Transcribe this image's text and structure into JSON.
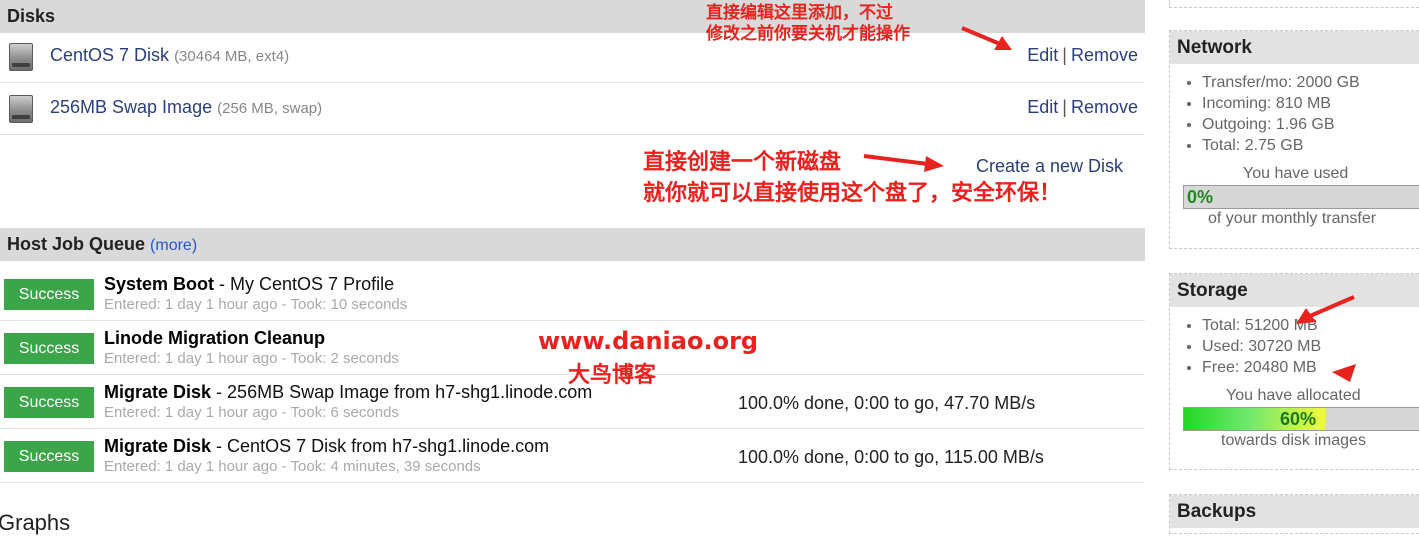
{
  "disks": {
    "header": "Disks",
    "items": [
      {
        "name": "CentOS 7 Disk",
        "meta": "(30464 MB, ext4)",
        "edit": "Edit",
        "remove": "Remove"
      },
      {
        "name": "256MB Swap Image",
        "meta": "(256 MB, swap)",
        "edit": "Edit",
        "remove": "Remove"
      }
    ],
    "create_label": "Create a new Disk",
    "separator": "|"
  },
  "annotations": {
    "edit_note_line1": "直接编辑这里添加，不过",
    "edit_note_line2": "修改之前你要关机才能操作",
    "create_note_line1": "直接创建一个新磁盘",
    "create_note_line2": "就你就可以直接使用这个盘了，安全环保！",
    "watermark_url": "www.daniao.org",
    "watermark_name": "大鸟博客"
  },
  "jobs": {
    "header": "Host Job Queue",
    "more": "(more)",
    "items": [
      {
        "status": "Success",
        "title_bold": "System Boot",
        "title_rest": " - My CentOS 7 Profile",
        "sub": "Entered: 1 day 1 hour ago - Took: 10 seconds",
        "progress": ""
      },
      {
        "status": "Success",
        "title_bold": "Linode Migration Cleanup",
        "title_rest": "",
        "sub": "Entered: 1 day 1 hour ago - Took: 2 seconds",
        "progress": ""
      },
      {
        "status": "Success",
        "title_bold": "Migrate Disk",
        "title_rest": " - 256MB Swap Image from h7-shg1.linode.com",
        "sub": "Entered: 1 day 1 hour ago - Took: 6 seconds",
        "progress": "100.0% done, 0:00 to go, 47.70 MB/s"
      },
      {
        "status": "Success",
        "title_bold": "Migrate Disk",
        "title_rest": " - CentOS 7 Disk from h7-shg1.linode.com",
        "sub": "Entered: 1 day 1 hour ago - Took: 4 minutes, 39 seconds",
        "progress": "100.0% done, 0:00 to go, 115.00 MB/s"
      }
    ]
  },
  "graphs": {
    "title": "Graphs"
  },
  "network": {
    "header": "Network",
    "items": [
      "Transfer/mo: 2000 GB",
      "Incoming: 810 MB",
      "Outgoing: 1.96 GB",
      "Total: 2.75 GB"
    ],
    "used_label": "You have used",
    "percent_label": "0%",
    "percent_value": 0,
    "caption": "of your monthly transfer"
  },
  "storage": {
    "header": "Storage",
    "items": [
      "Total: 51200 MB",
      "Used: 30720 MB",
      "Free: 20480 MB"
    ],
    "alloc_label": "You have allocated",
    "percent_label": "60%",
    "percent_value": 0.6,
    "caption": "towards disk images"
  },
  "backups": {
    "header": "Backups"
  },
  "colors": {
    "success": "#3aa549",
    "link": "#2a3f7a",
    "annotation": "#e8231f",
    "bar_green": "#28e028"
  }
}
